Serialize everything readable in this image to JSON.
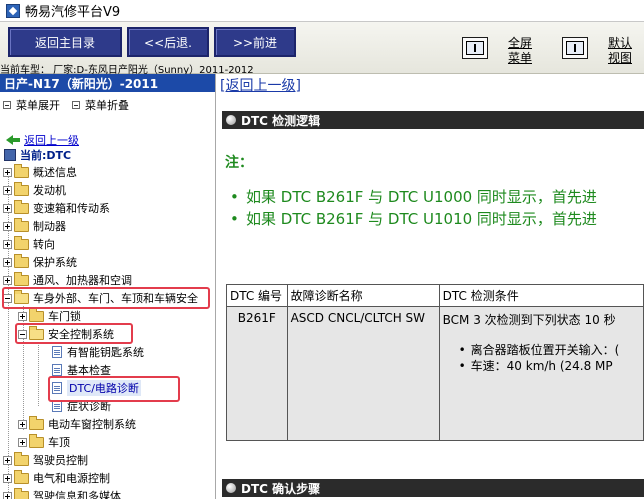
{
  "window": {
    "title": "畅易汽修平台V9"
  },
  "toolbar": {
    "home_label": "返回主目录",
    "back_label": "<<后退.",
    "forward_label": ">>前进",
    "fullscreen_label_1": "全屏",
    "fullscreen_label_2": "菜单",
    "default_view_label_1": "默认",
    "default_view_label_2": "视图"
  },
  "model_line": "当前车型： 厂家:D-东风日产阳光（Sunny）2011-2012",
  "sidebar": {
    "vehicle": "日产-N17（新阳光）-2011",
    "expand_all": "菜单展开",
    "collapse_all": "菜单折叠",
    "back_link": "返回上一级",
    "current": "当前:DTC",
    "tree": [
      "概述信息",
      "发动机",
      "变速箱和传动系",
      "制动器",
      "转向",
      "保护系统",
      "通风、加热器和空调",
      "车身外部、车门、车顶和车辆安全",
      "车门锁",
      "安全控制系统",
      "有智能钥匙系统",
      "基本检查",
      "DTC/电路诊断",
      "症状诊断",
      "电动车窗控制系统",
      "车顶",
      "驾驶员控制",
      "电气和电源控制",
      "驾驶信息和多媒体"
    ]
  },
  "content": {
    "return_link": "[返回上一级]",
    "section1": "DTC 检测逻辑",
    "note_label": "注：",
    "notes": [
      "如果 DTC B261F 与 DTC U1000 同时显示，首先进",
      "如果 DTC B261F 与 DTC U1010 同时显示，首先进"
    ],
    "table": {
      "headers": [
        "DTC 编号",
        "故障诊断名称",
        "DTC 检测条件"
      ],
      "row": {
        "code": "B261F",
        "name": "ASCD CNCL/CLTCH SW",
        "condition": "BCM 3 次检测到下列状态 10 秒",
        "items": [
          "离合器踏板位置开关输入：(",
          "车速：40 km/h (24.8 MP"
        ]
      }
    },
    "section2": "DTC 确认步骤"
  },
  "colors": {
    "nav_button": "#2e3a8a",
    "vehicle_bar": "#1c4aa8",
    "section_bar": "#2b2b2b",
    "note_green": "#1e8a1e",
    "highlight_red": "#e33c4c"
  }
}
